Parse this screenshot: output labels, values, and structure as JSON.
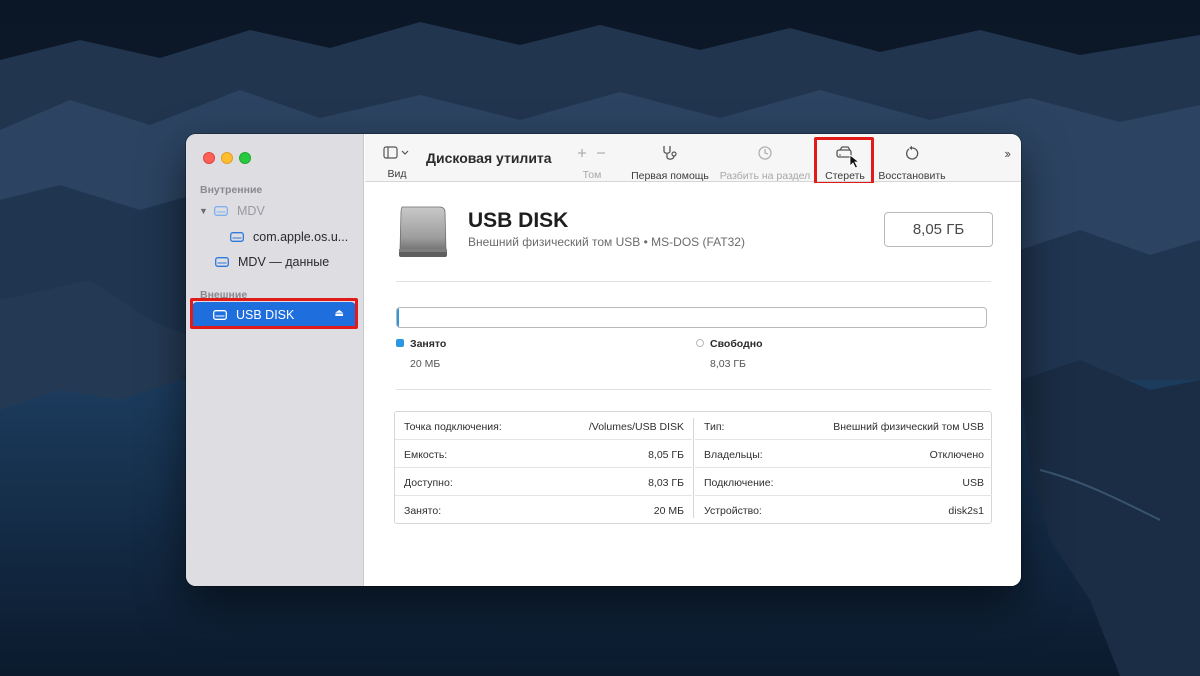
{
  "window": {
    "sidebar": {
      "sections": [
        {
          "label": "Внутренние"
        },
        {
          "label": "Внешние"
        }
      ],
      "items": [
        {
          "label": "MDV"
        },
        {
          "label": "com.apple.os.u..."
        },
        {
          "label": "MDV — данные"
        },
        {
          "label": "USB DISK"
        }
      ]
    },
    "toolbar": {
      "title": "Дисковая утилита",
      "view_label": "Вид",
      "volume_label": "Том",
      "first_aid_label": "Первая помощь",
      "partition_label": "Разбить на раздел",
      "erase_label": "Стереть",
      "restore_label": "Восстановить"
    },
    "disk": {
      "name": "USB DISK",
      "subtitle": "Внешний физический том USB • MS-DOS (FAT32)",
      "size": "8,05 ГБ",
      "used_fraction": 0.0025,
      "used_label": "Занято",
      "used_value": "20 МБ",
      "free_label": "Свободно",
      "free_value": "8,03 ГБ",
      "used_color": "#2a97e0"
    },
    "info": {
      "left": [
        {
          "key": "Точка подключения:",
          "value": "/Volumes/USB DISK"
        },
        {
          "key": "Емкость:",
          "value": "8,05 ГБ"
        },
        {
          "key": "Доступно:",
          "value": "8,03 ГБ"
        },
        {
          "key": "Занято:",
          "value": "20 МБ"
        }
      ],
      "right": [
        {
          "key": "Тип:",
          "value": "Внешний физический том USB"
        },
        {
          "key": "Владельцы:",
          "value": "Отключено"
        },
        {
          "key": "Подключение:",
          "value": "USB"
        },
        {
          "key": "Устройство:",
          "value": "disk2s1"
        }
      ]
    }
  },
  "icons": {
    "sidebar": "sidebar-toggle-icon",
    "add": "plus-icon",
    "remove": "minus-icon",
    "first_aid": "stethoscope-icon",
    "partition": "pie-clock-icon",
    "erase": "erase-disk-icon",
    "restore": "restore-arrow-icon",
    "eject": "eject-icon",
    "pointer": "mouse-pointer-icon"
  },
  "colors": {
    "accent": "#1f6ede",
    "highlight": "#e11a1a"
  }
}
